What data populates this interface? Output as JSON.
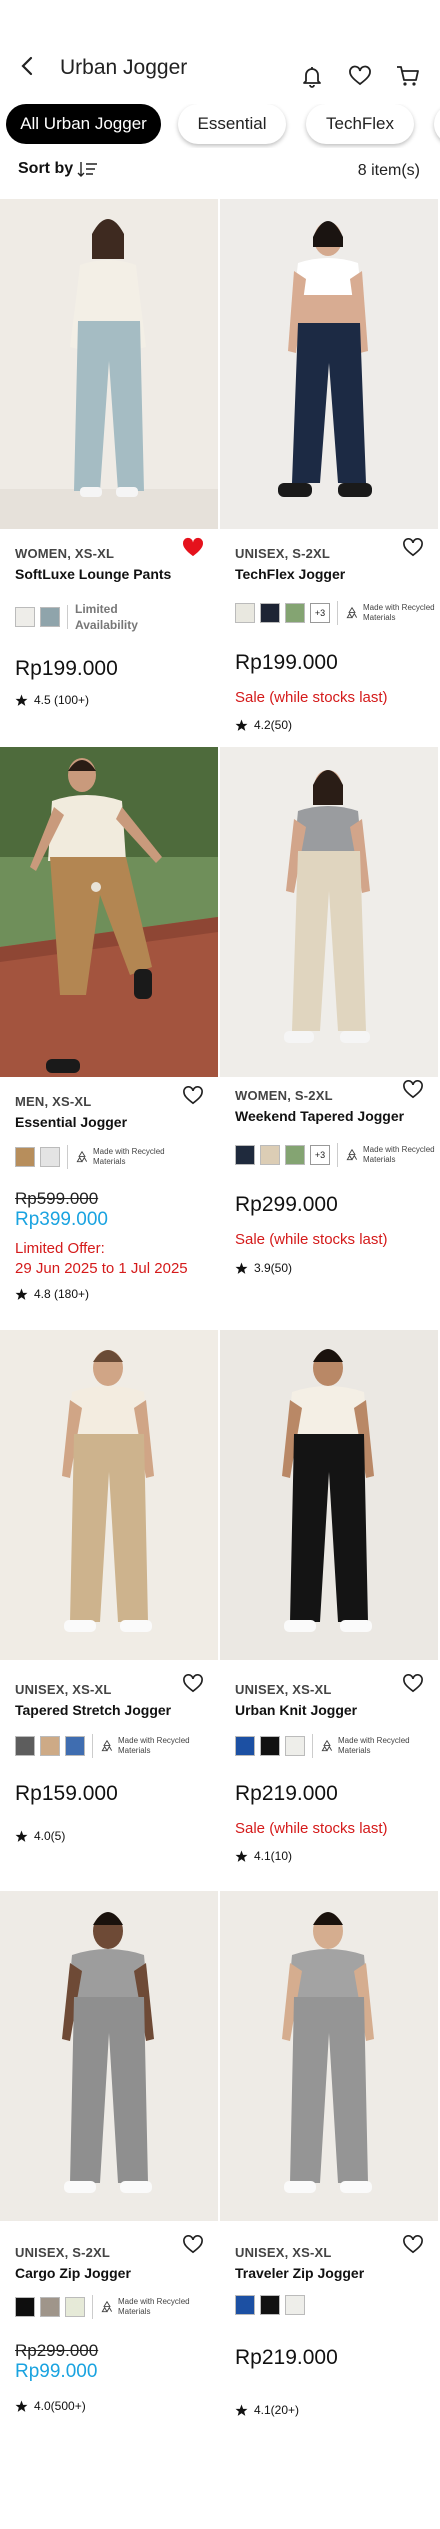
{
  "header": {
    "title": "Urban Jogger",
    "back_icon": "chevron-left-icon",
    "icons": [
      "bell-icon",
      "heart-icon",
      "cart-icon"
    ]
  },
  "chips": [
    {
      "label": "All Urban Jogger",
      "active": true
    },
    {
      "label": "Essential",
      "active": false
    },
    {
      "label": "TechFlex",
      "active": false
    }
  ],
  "sort": {
    "label": "Sort by",
    "icon": "sort-icon"
  },
  "item_count": "8 item(s)",
  "recycled_label": "Made with Recycled Materials",
  "products": [
    {
      "meta": "WOMEN, XS-XL",
      "name": "SoftLuxe Lounge Pants",
      "liked": true,
      "swatches": [
        "#eeede9",
        "#8fa4ab"
      ],
      "availability": "Limited Availability",
      "price": "Rp199.000",
      "rating": "4.5 (100+)"
    },
    {
      "meta": "UNISEX, S-2XL",
      "name": "TechFlex Jogger",
      "liked": false,
      "swatches": [
        "#e9e8e0",
        "#1d2434",
        "#84a472"
      ],
      "more": "+3",
      "recycled": true,
      "price": "Rp199.000",
      "sale": "Sale (while stocks last)",
      "rating": "4.2(50)"
    },
    {
      "meta": "MEN, XS-XL",
      "name": "Essential Jogger",
      "liked": false,
      "swatches": [
        "#b78e5c",
        "#e4e4e4"
      ],
      "recycled": true,
      "old_price": "Rp599.000",
      "new_price": "Rp399.000",
      "offer": [
        "Limited Offer:",
        "29 Jun 2025 to 1 Jul 2025"
      ],
      "rating": "4.8 (180+)"
    },
    {
      "meta": "WOMEN, S-2XL",
      "name": "Weekend Tapered Jogger",
      "liked": false,
      "swatches": [
        "#1f2a3d",
        "#dccdb5",
        "#84a472"
      ],
      "more": "+3",
      "recycled": true,
      "price": "Rp299.000",
      "sale": "Sale (while stocks last)",
      "rating": "3.9(50)"
    },
    {
      "meta": "UNISEX, XS-XL",
      "name": "Tapered Stretch Jogger",
      "liked": false,
      "swatches": [
        "#5d5d5d",
        "#cdaa86",
        "#3f6db0"
      ],
      "recycled": true,
      "price": "Rp159.000",
      "rating": "4.0(5)"
    },
    {
      "meta": "UNISEX, XS-XL",
      "name": "Urban Knit Jogger",
      "liked": false,
      "swatches": [
        "#1c50a3",
        "#111111",
        "#eeeeea"
      ],
      "recycled": true,
      "price": "Rp219.000",
      "sale": "Sale (while stocks last)",
      "rating": "4.1(10)"
    },
    {
      "meta": "UNISEX, S-2XL",
      "name": "Cargo Zip Jogger",
      "liked": false,
      "swatches": [
        "#0e0e0e",
        "#9f958a",
        "#e6ead8"
      ],
      "recycled": true,
      "old_price": "Rp299.000",
      "new_price": "Rp99.000",
      "rating": "4.0(500+)"
    },
    {
      "meta": "UNISEX, XS-XL",
      "name": "Traveler Zip Jogger",
      "liked": false,
      "swatches": [
        "#1c50a3",
        "#111111",
        "#eeeeea"
      ],
      "price": "Rp219.000",
      "rating": "4.1(20+)"
    }
  ],
  "colors": {
    "sale": "#d41a1a",
    "discount": "#1aa3e0",
    "liked_heart": "#e5121c"
  }
}
